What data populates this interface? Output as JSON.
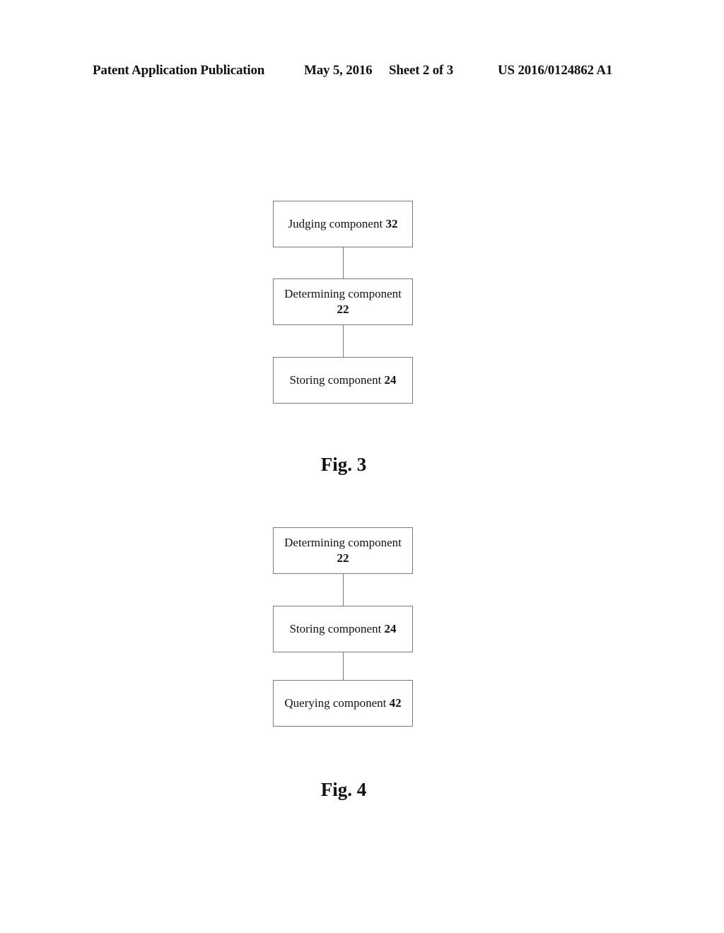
{
  "header": {
    "publication": "Patent Application Publication",
    "date": "May 5, 2016",
    "sheet": "Sheet 2 of 3",
    "number": "US 2016/0124862 A1"
  },
  "figures": [
    {
      "label": "Fig. 3",
      "boxes": [
        {
          "text": "Judging component",
          "num": "32"
        },
        {
          "text": "Determining component",
          "num": "22"
        },
        {
          "text": "Storing component",
          "num": "24"
        }
      ]
    },
    {
      "label": "Fig. 4",
      "boxes": [
        {
          "text": "Determining component",
          "num": "22"
        },
        {
          "text": "Storing component",
          "num": "24"
        },
        {
          "text": "Querying component",
          "num": "42"
        }
      ]
    }
  ]
}
